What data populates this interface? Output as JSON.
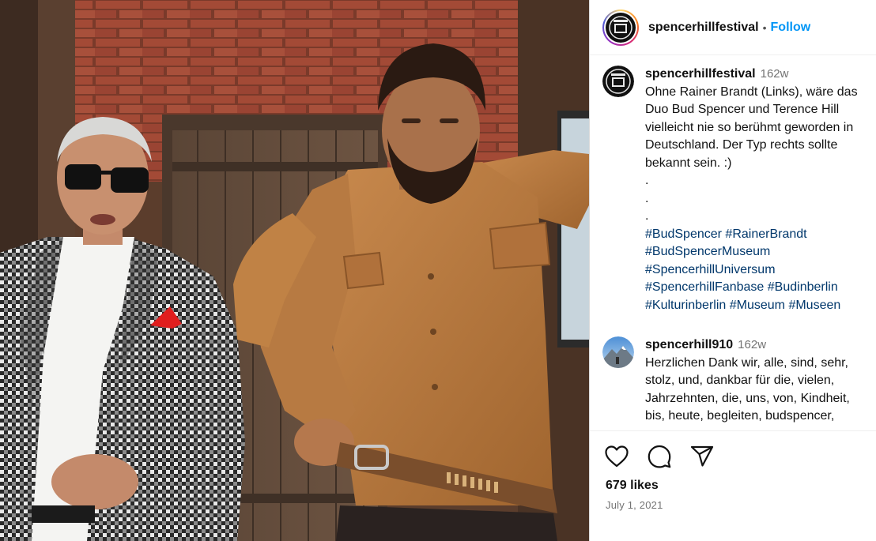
{
  "post": {
    "image_alt": "Rainer Brandt standing next to a Bud Spencer figure",
    "author": {
      "username": "spencerhillfestival",
      "separator": "•",
      "follow_label": "Follow"
    },
    "caption": {
      "username": "spencerhillfestival",
      "time": "162w",
      "text_line1": "Ohne Rainer Brandt (Links), wäre das Duo Bud Spencer und Terence Hill vielleicht nie so berühmt geworden in Deutschland. Der Typ rechts sollte bekannt sein. :)",
      "dots": [
        ".",
        ".",
        "."
      ],
      "hashtags_lines": [
        [
          "#BudSpencer",
          "#RainerBrandt"
        ],
        [
          "#BudSpencerMuseum"
        ],
        [
          "#SpencerhillUniversum"
        ],
        [
          "#SpencerhillFanbase",
          "#Budinberlin"
        ],
        [
          "#Kulturinberlin",
          "#Museum",
          "#Museen"
        ]
      ]
    },
    "reply": {
      "username": "spencerhill910",
      "time": "162w",
      "text": "Herzlichen Dank wir, alle, sind, sehr, stolz, und, dankbar für die, vielen, Jahrzehnten, die, uns, von, Kindheit, bis, heute, begleiten, budspencer,",
      "edge_mark": "("
    },
    "likes": "679 likes",
    "date": "July 1, 2021",
    "icons": {
      "like": "heart-icon",
      "comment": "comment-icon",
      "share": "share-icon"
    },
    "colors": {
      "link_blue": "#0095f6",
      "hashtag_blue": "#00376b",
      "meta_gray": "#737373"
    }
  }
}
